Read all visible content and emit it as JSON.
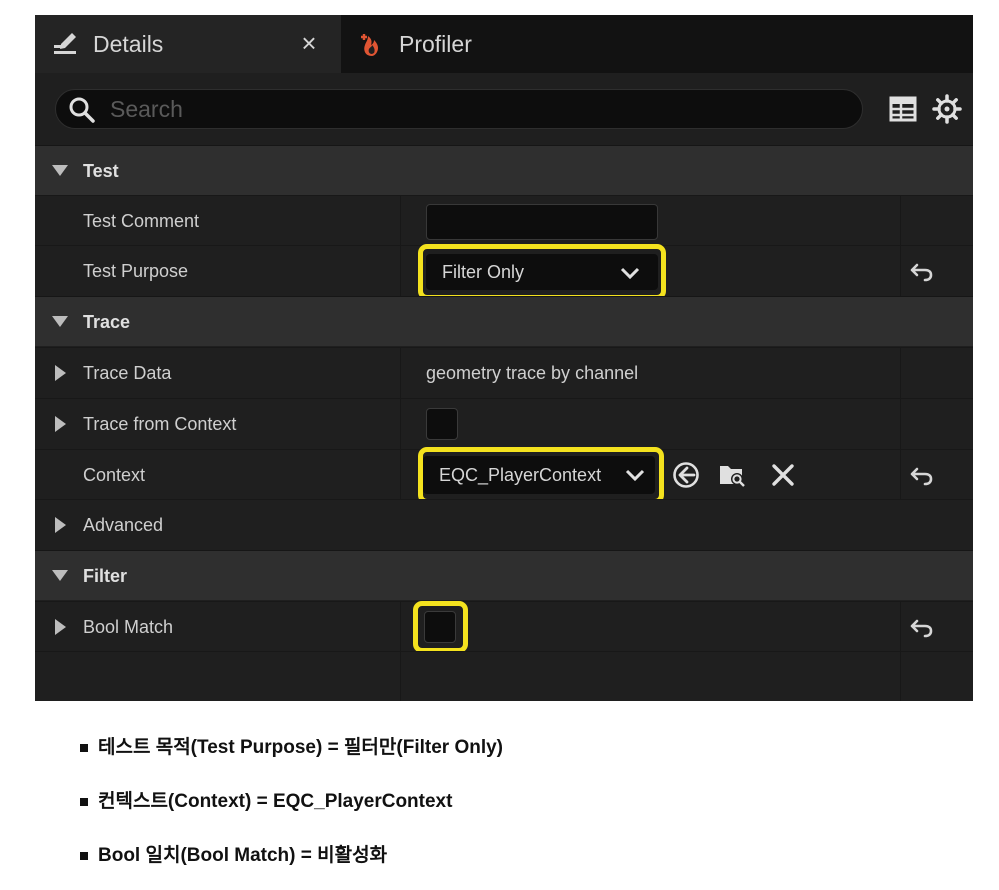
{
  "tabs": [
    {
      "label": "Details",
      "icon": "pencil-icon",
      "close": "×"
    },
    {
      "label": "Profiler",
      "icon": "flame-icon"
    }
  ],
  "search": {
    "placeholder": "Search"
  },
  "toolbar_icons": [
    "table-view-icon",
    "gear-icon"
  ],
  "sections": {
    "test": {
      "label": "Test",
      "test_comment": "Test Comment",
      "test_purpose": "Test Purpose",
      "test_purpose_value": "Filter Only"
    },
    "trace": {
      "label": "Trace",
      "trace_data": "Trace Data",
      "trace_data_value": "geometry trace by channel",
      "trace_from_context": "Trace from Context",
      "context": "Context",
      "context_value": "EQC_PlayerContext",
      "advanced": "Advanced"
    },
    "filter": {
      "label": "Filter",
      "bool_match": "Bool Match"
    }
  },
  "highlight_color": "#f4e21e",
  "notes": [
    "테스트 목적(Test Purpose) = 필터만(Filter Only)",
    "컨텍스트(Context) = EQC_PlayerContext",
    "Bool 일치(Bool Match) = 비활성화"
  ]
}
